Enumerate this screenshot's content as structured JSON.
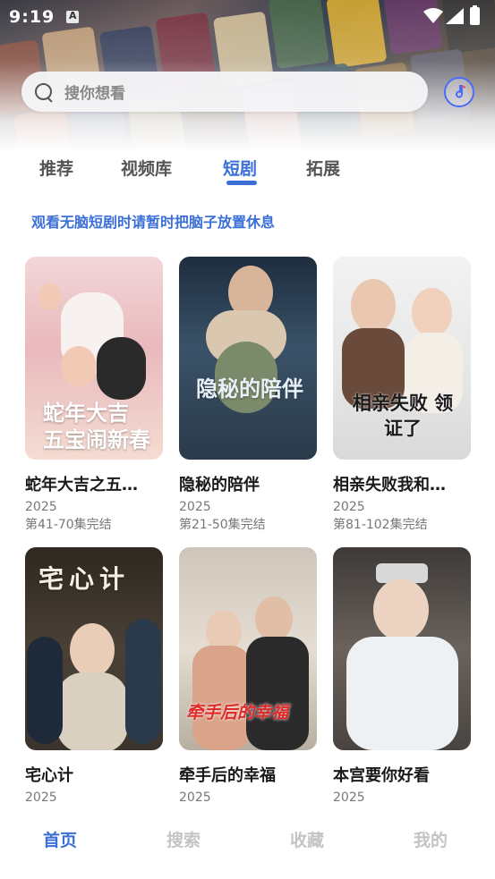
{
  "status_bar": {
    "time": "9:19"
  },
  "search": {
    "placeholder": "搜你想看"
  },
  "tabs": [
    {
      "label": "推荐",
      "active": false
    },
    {
      "label": "视频库",
      "active": false
    },
    {
      "label": "短剧",
      "active": true
    },
    {
      "label": "拓展",
      "active": false
    }
  ],
  "notice": "观看无脑短剧时请暂时把脑子放置休息",
  "items": [
    {
      "title": "蛇年大吉之五…",
      "year": "2025",
      "status": "第41-70集完结",
      "poster_text": "蛇年大吉 五宝闹新春"
    },
    {
      "title": "隐秘的陪伴",
      "year": "2025",
      "status": "第21-50集完结",
      "poster_text": "隐秘的陪伴"
    },
    {
      "title": "相亲失败我和…",
      "year": "2025",
      "status": "第81-102集完结",
      "poster_text": "相亲失败 领证了"
    },
    {
      "title": "宅心计",
      "year": "2025",
      "status": "",
      "poster_text": "宅心计"
    },
    {
      "title": "牵手后的幸福",
      "year": "2025",
      "status": "",
      "poster_text": "牵手后的幸福"
    },
    {
      "title": "本宫要你好看",
      "year": "2025",
      "status": "",
      "poster_text": ""
    }
  ],
  "bottom_nav": [
    {
      "label": "首页",
      "active": true
    },
    {
      "label": "搜索",
      "active": false
    },
    {
      "label": "收藏",
      "active": false
    },
    {
      "label": "我的",
      "active": false
    }
  ],
  "colors": {
    "accent": "#3b6fd8",
    "inactive_nav": "#c4c4c4"
  },
  "icons": [
    "search-icon",
    "music-icon",
    "wifi-icon",
    "signal-icon",
    "battery-icon"
  ]
}
